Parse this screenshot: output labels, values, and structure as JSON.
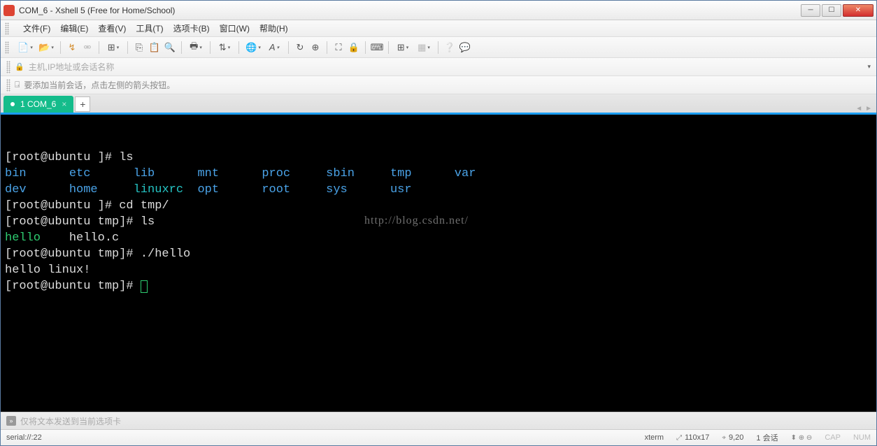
{
  "window": {
    "title": "COM_6 - Xshell 5 (Free for Home/School)"
  },
  "menu": {
    "file": "文件(F)",
    "edit": "编辑(E)",
    "view": "查看(V)",
    "tools": "工具(T)",
    "tabs": "选项卡(B)",
    "window": "窗口(W)",
    "help": "帮助(H)"
  },
  "addressbar": {
    "placeholder": "主机,IP地址或会话名称"
  },
  "hint": {
    "text": "要添加当前会话，点击左侧的箭头按钮。"
  },
  "tab": {
    "label": "1 COM_6"
  },
  "terminal": {
    "lines": [
      {
        "segs": [
          {
            "t": "[root@ubuntu ]# ls",
            "c": "prompt"
          }
        ]
      },
      {
        "segs": [
          {
            "t": "bin",
            "c": "dir"
          },
          {
            "t": "      ",
            "c": ""
          },
          {
            "t": "etc",
            "c": "dir"
          },
          {
            "t": "      ",
            "c": ""
          },
          {
            "t": "lib",
            "c": "dir"
          },
          {
            "t": "      ",
            "c": ""
          },
          {
            "t": "mnt",
            "c": "dir"
          },
          {
            "t": "      ",
            "c": ""
          },
          {
            "t": "proc",
            "c": "dir"
          },
          {
            "t": "     ",
            "c": ""
          },
          {
            "t": "sbin",
            "c": "dir"
          },
          {
            "t": "     ",
            "c": ""
          },
          {
            "t": "tmp",
            "c": "dir"
          },
          {
            "t": "      ",
            "c": ""
          },
          {
            "t": "var",
            "c": "dir"
          }
        ]
      },
      {
        "segs": [
          {
            "t": "dev",
            "c": "dir"
          },
          {
            "t": "      ",
            "c": ""
          },
          {
            "t": "home",
            "c": "dir"
          },
          {
            "t": "     ",
            "c": ""
          },
          {
            "t": "linuxrc",
            "c": "link"
          },
          {
            "t": "  ",
            "c": ""
          },
          {
            "t": "opt",
            "c": "dir"
          },
          {
            "t": "      ",
            "c": ""
          },
          {
            "t": "root",
            "c": "dir"
          },
          {
            "t": "     ",
            "c": ""
          },
          {
            "t": "sys",
            "c": "dir"
          },
          {
            "t": "      ",
            "c": ""
          },
          {
            "t": "usr",
            "c": "dir"
          }
        ]
      },
      {
        "segs": [
          {
            "t": "[root@ubuntu ]# cd tmp/",
            "c": "prompt"
          }
        ]
      },
      {
        "segs": [
          {
            "t": "[root@ubuntu tmp]# ls",
            "c": "prompt"
          }
        ]
      },
      {
        "segs": [
          {
            "t": "hello",
            "c": "exe"
          },
          {
            "t": "    hello.c",
            "c": "prompt"
          }
        ]
      },
      {
        "segs": [
          {
            "t": "[root@ubuntu tmp]# ./hello",
            "c": "prompt"
          }
        ]
      },
      {
        "segs": [
          {
            "t": "hello linux!",
            "c": "prompt"
          }
        ]
      },
      {
        "segs": [
          {
            "t": "[root@ubuntu tmp]# ",
            "c": "prompt"
          },
          {
            "t": "",
            "c": "cursor"
          }
        ]
      }
    ],
    "watermark": "http://blog.csdn.net/"
  },
  "bottominput": {
    "placeholder": "仅将文本发送到当前选项卡"
  },
  "status": {
    "left": "serial://:22",
    "term": "xterm",
    "size": "110x17",
    "pos": "9,20",
    "sessions": "1 会话",
    "caps": "CAP",
    "num": "NUM"
  }
}
